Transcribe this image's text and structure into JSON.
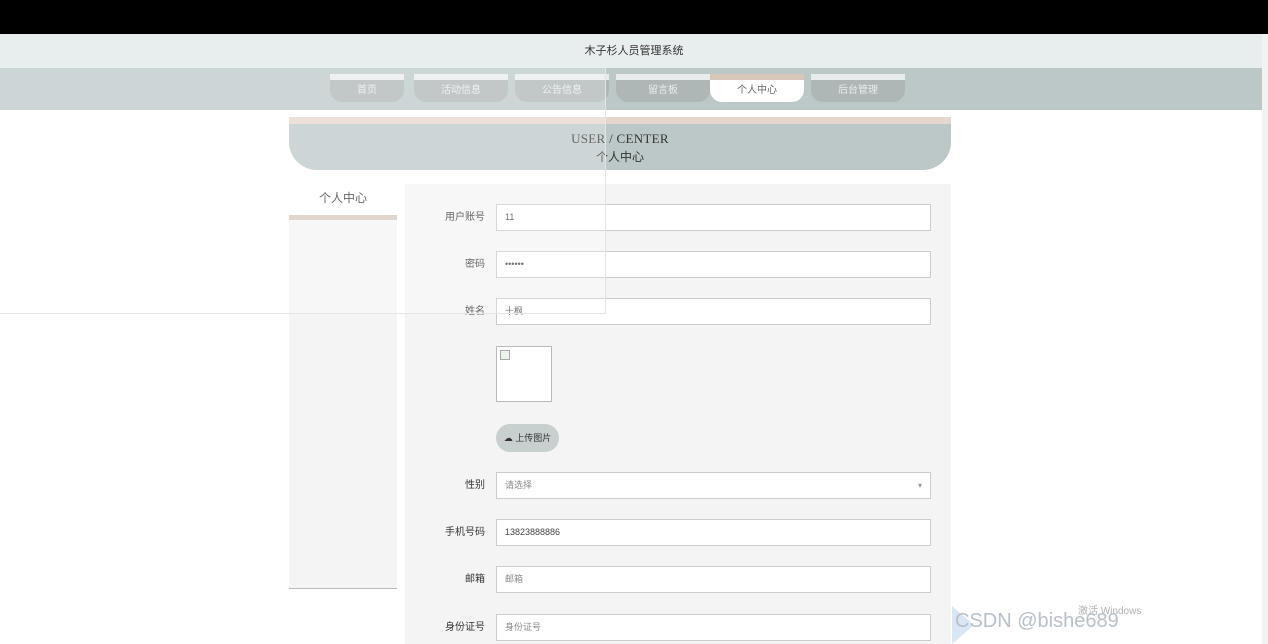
{
  "app": {
    "title": "木子杉人员管理系统"
  },
  "nav": {
    "items": [
      {
        "label": "首页"
      },
      {
        "label": "活动信息"
      },
      {
        "label": "公告信息"
      },
      {
        "label": "留言板"
      },
      {
        "label": "个人中心",
        "active": true
      },
      {
        "label": "后台管理"
      }
    ]
  },
  "banner": {
    "title_en": "USER / CENTER",
    "title_cn": "个人中心"
  },
  "sidebar": {
    "heading": "个人中心"
  },
  "form": {
    "account": {
      "label": "用户账号",
      "value": "11"
    },
    "password": {
      "label": "密码",
      "value": "••••••"
    },
    "name": {
      "label": "姓名",
      "value": "十枫"
    },
    "upload": {
      "button_label": "上传图片",
      "icon": "upload-icon"
    },
    "gender": {
      "label": "性别",
      "placeholder": "请选择"
    },
    "phone": {
      "label": "手机号码",
      "value": "13823888886"
    },
    "email": {
      "label": "邮箱",
      "placeholder": "邮箱"
    },
    "idcard": {
      "label": "身份证号",
      "placeholder": "身份证号"
    }
  },
  "watermark": {
    "text": "CSDN @bishe689",
    "overlay": "激活 Windows"
  },
  "colors": {
    "accent_tan": "#d7c7bb",
    "nav_bg": "#bcc8c8",
    "panel_bg": "#f4f4f4"
  }
}
